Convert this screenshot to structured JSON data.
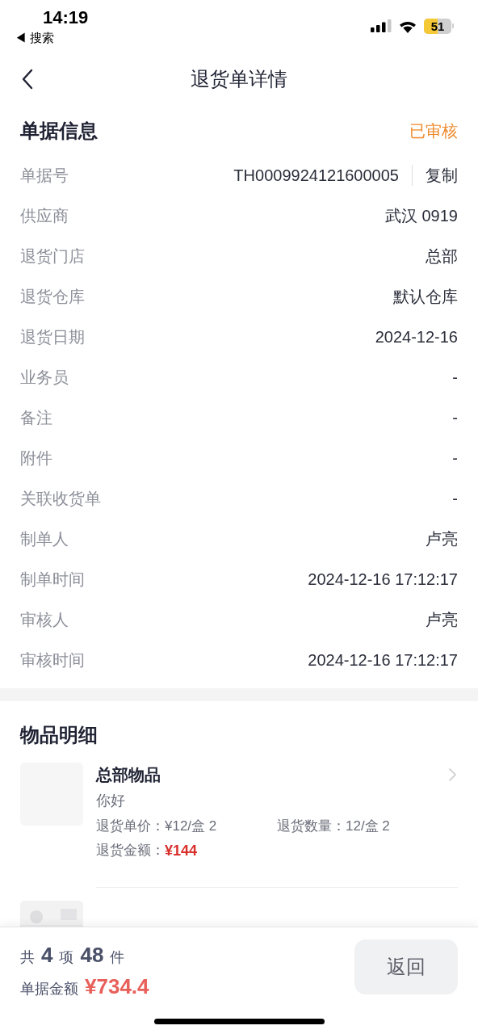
{
  "status_bar": {
    "time": "14:19",
    "back_app": "◀ 搜索",
    "battery": "51"
  },
  "header": {
    "title": "退货单详情"
  },
  "info": {
    "title": "单据信息",
    "status": "已审核",
    "rows": [
      {
        "label": "单据号",
        "value": "TH0009924121600005",
        "action": "复制"
      },
      {
        "label": "供应商",
        "value": "武汉 0919"
      },
      {
        "label": "退货门店",
        "value": "总部"
      },
      {
        "label": "退货仓库",
        "value": "默认仓库"
      },
      {
        "label": "退货日期",
        "value": "2024-12-16"
      },
      {
        "label": "业务员",
        "value": "-"
      },
      {
        "label": "备注",
        "value": "-"
      },
      {
        "label": "附件",
        "value": "-"
      },
      {
        "label": "关联收货单",
        "value": "-"
      },
      {
        "label": "制单人",
        "value": "卢亮"
      },
      {
        "label": "制单时间",
        "value": "2024-12-16 17:12:17"
      },
      {
        "label": "审核人",
        "value": "卢亮"
      },
      {
        "label": "审核时间",
        "value": "2024-12-16 17:12:17"
      }
    ]
  },
  "items": {
    "title": "物品明细",
    "list": [
      {
        "name": "总部物品",
        "spec": "你好",
        "price_label": "退货单价：",
        "price": "¥12/盒 2",
        "qty_label": "退货数量：",
        "qty": "12/盒 2",
        "amount_label": "退货金额：",
        "amount": "¥144"
      },
      {
        "kind": "picture"
      }
    ]
  },
  "footer": {
    "prefix": "共",
    "item_count": "4",
    "item_unit": "项",
    "piece_count": "48",
    "piece_unit": "件",
    "amount_label": "单据金额",
    "amount": "¥734.4",
    "button": "返回"
  }
}
